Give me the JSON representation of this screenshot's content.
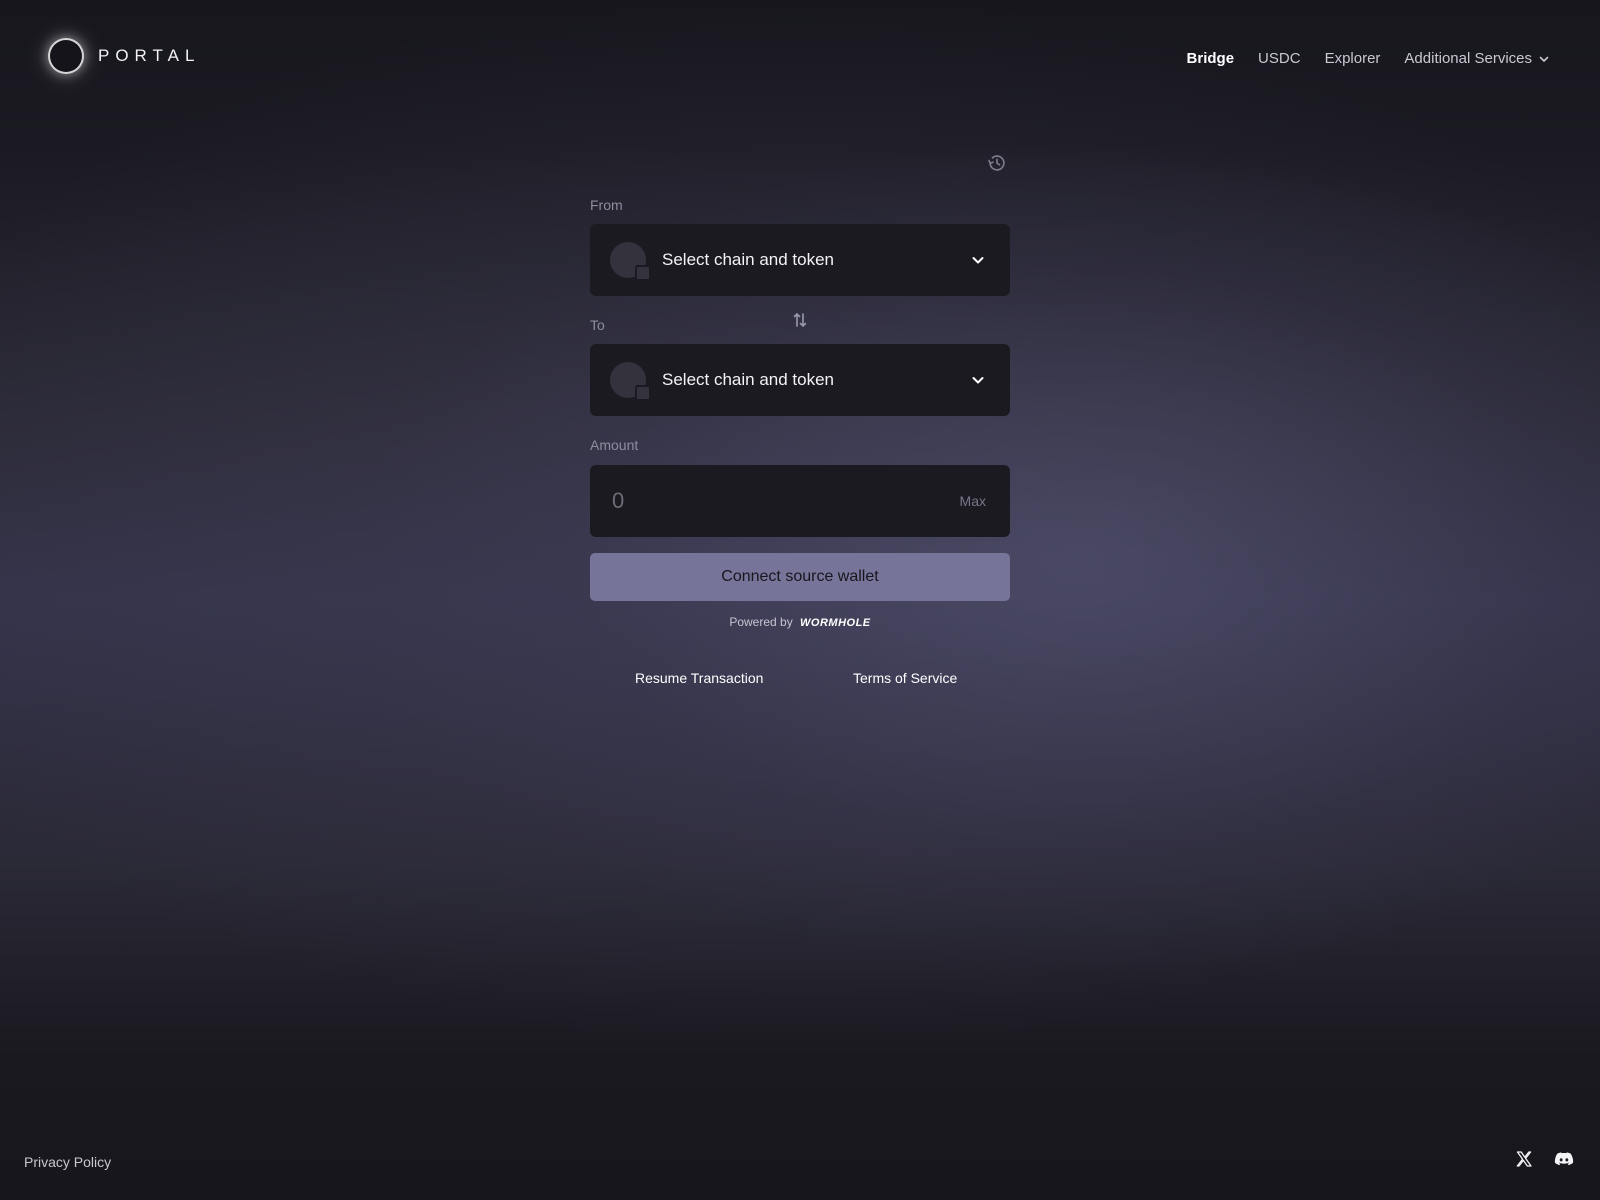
{
  "header": {
    "logo_text": "PORTAL",
    "nav": [
      {
        "label": "Bridge",
        "active": true
      },
      {
        "label": "USDC",
        "active": false
      },
      {
        "label": "Explorer",
        "active": false
      },
      {
        "label": "Additional Services",
        "active": false
      }
    ]
  },
  "bridge": {
    "history_icon": "history-icon",
    "from": {
      "label": "From",
      "placeholder": "Select chain and token"
    },
    "to": {
      "label": "To",
      "placeholder": "Select chain and token"
    },
    "swap_icon": "swap-vertical-icon",
    "amount": {
      "label": "Amount",
      "placeholder": "0",
      "max_label": "Max"
    },
    "connect_button": "Connect source wallet",
    "powered_by": "Powered by",
    "powered_brand": "WORMHOLE",
    "resume_link": "Resume Transaction",
    "tos_link": "Terms of Service"
  },
  "footer": {
    "privacy": "Privacy Policy",
    "social": [
      "x-icon",
      "discord-icon"
    ]
  },
  "colors": {
    "accent_button": "#77749a",
    "card_bg": "#1b1a21"
  }
}
